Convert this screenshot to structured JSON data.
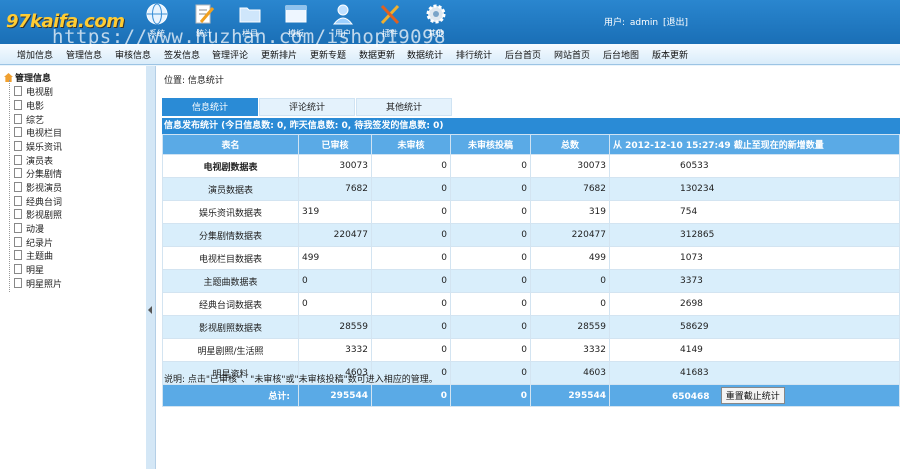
{
  "header": {
    "logo_text": "97kaifa.com",
    "toolbar": [
      {
        "label": "系统",
        "icon": "globe-icon"
      },
      {
        "label": "统计",
        "icon": "notepad-icon"
      },
      {
        "label": "栏目",
        "icon": "folder-icon"
      },
      {
        "label": "模板",
        "icon": "window-icon"
      },
      {
        "label": "用户",
        "icon": "user-icon"
      },
      {
        "label": "插件",
        "icon": "tools-icon"
      },
      {
        "label": "其他",
        "icon": "gear-icon"
      }
    ],
    "user_label": "用户:",
    "username": "admin",
    "logout": "[退出]",
    "watermark": "https://www.huzhan.com/ishop19098"
  },
  "menu": [
    "增加信息",
    "管理信息",
    "审核信息",
    "签发信息",
    "管理评论",
    "更新排片",
    "更新专题",
    "数据更新",
    "数据统计",
    "排行统计",
    "后台首页",
    "网站首页",
    "后台地图",
    "版本更新"
  ],
  "sidebar": {
    "root": "管理信息",
    "items": [
      "电视剧",
      "电影",
      "综艺",
      "电视栏目",
      "娱乐资讯",
      "演员表",
      "分集剧情",
      "影视演员",
      "经典台词",
      "影视剧照",
      "动漫",
      "纪录片",
      "主题曲",
      "明星",
      "明星照片"
    ]
  },
  "main": {
    "location": "位置: 信息统计",
    "tabs": [
      "信息统计",
      "评论统计",
      "其他统计"
    ],
    "stat_title": "信息发布统计 (今日信息数: 0, 昨天信息数: 0, 待我签发的信息数: 0)",
    "columns": [
      "表名",
      "已审核",
      "未审核",
      "未审核投稿",
      "总数",
      "从 2012-12-10 15:27:49 截止至现在的新增数量"
    ],
    "rows": [
      {
        "name": "电视剧数据表",
        "approved": "30073",
        "pending": "0",
        "pending_submit": "0",
        "total": "30073",
        "new": "60533"
      },
      {
        "name": "演员数据表",
        "approved": "7682",
        "pending": "0",
        "pending_submit": "0",
        "total": "7682",
        "new": "130234"
      },
      {
        "name": "娱乐资讯数据表",
        "approved": "319",
        "pending": "0",
        "pending_submit": "0",
        "total": "319",
        "new": "754"
      },
      {
        "name": "分集剧情数据表",
        "approved": "220477",
        "pending": "0",
        "pending_submit": "0",
        "total": "220477",
        "new": "312865"
      },
      {
        "name": "电视栏目数据表",
        "approved": "499",
        "pending": "0",
        "pending_submit": "0",
        "total": "499",
        "new": "1073"
      },
      {
        "name": "主题曲数据表",
        "approved": "0",
        "pending": "0",
        "pending_submit": "0",
        "total": "0",
        "new": "3373"
      },
      {
        "name": "经典台词数据表",
        "approved": "0",
        "pending": "0",
        "pending_submit": "0",
        "total": "0",
        "new": "2698"
      },
      {
        "name": "影视剧照数据表",
        "approved": "28559",
        "pending": "0",
        "pending_submit": "0",
        "total": "28559",
        "new": "58629"
      },
      {
        "name": "明星剧照/生活照",
        "approved": "3332",
        "pending": "0",
        "pending_submit": "0",
        "total": "3332",
        "new": "4149"
      },
      {
        "name": "明星资料",
        "approved": "4603",
        "pending": "0",
        "pending_submit": "0",
        "total": "4603",
        "new": "41683"
      }
    ],
    "totals": {
      "label": "总计:",
      "approved": "295544",
      "pending": "0",
      "pending_submit": "0",
      "total": "295544",
      "new": "650468"
    },
    "reset_button": "重置截止统计",
    "note": "说明: 点击\"已审核\"、\"未审核\"或\"未审核投稿\"数可进入相应的管理。"
  },
  "colors": {
    "header_blue": "#1a6fb6",
    "tab_active": "#2a8bd6",
    "table_header": "#5aaae6",
    "row_alt": "#d9eefb"
  }
}
